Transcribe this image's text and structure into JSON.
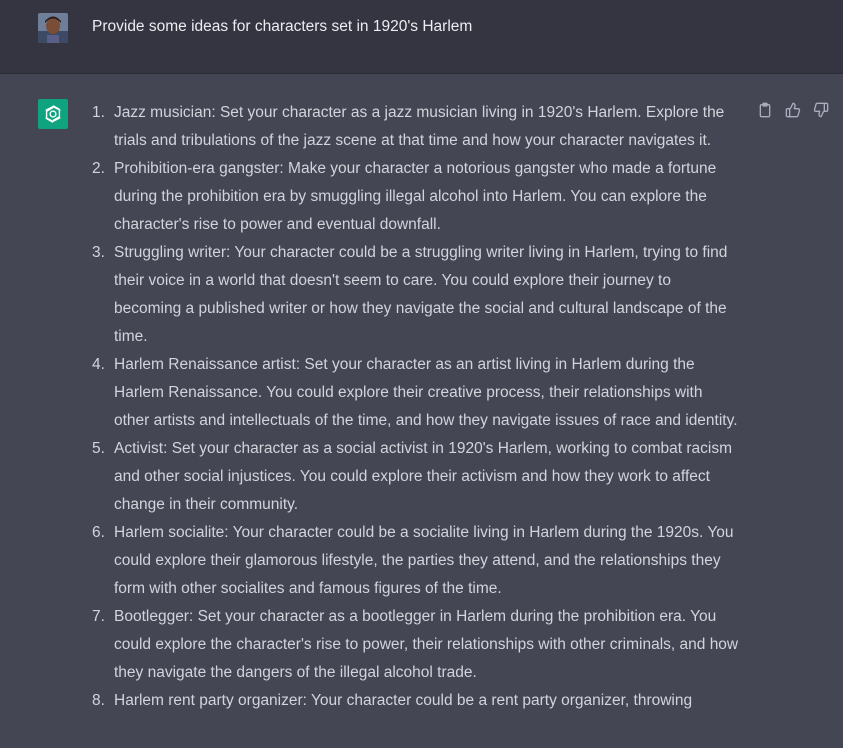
{
  "user_message": {
    "text": "Provide some ideas for characters set in 1920's Harlem"
  },
  "assistant_message": {
    "items": [
      {
        "num": "1.",
        "text": "Jazz musician: Set your character as a jazz musician living in 1920's Harlem. Explore the trials and tribulations of the jazz scene at that time and how your character navigates it."
      },
      {
        "num": "2.",
        "text": "Prohibition-era gangster: Make your character a notorious gangster who made a fortune during the prohibition era by smuggling illegal alcohol into Harlem. You can explore the character's rise to power and eventual downfall."
      },
      {
        "num": "3.",
        "text": "Struggling writer: Your character could be a struggling writer living in Harlem, trying to find their voice in a world that doesn't seem to care. You could explore their journey to becoming a published writer or how they navigate the social and cultural landscape of the time."
      },
      {
        "num": "4.",
        "text": "Harlem Renaissance artist: Set your character as an artist living in Harlem during the Harlem Renaissance. You could explore their creative process, their relationships with other artists and intellectuals of the time, and how they navigate issues of race and identity."
      },
      {
        "num": "5.",
        "text": "Activist: Set your character as a social activist in 1920's Harlem, working to combat racism and other social injustices. You could explore their activism and how they work to affect change in their community."
      },
      {
        "num": "6.",
        "text": "Harlem socialite: Your character could be a socialite living in Harlem during the 1920s. You could explore their glamorous lifestyle, the parties they attend, and the relationships they form with other socialites and famous figures of the time."
      },
      {
        "num": "7.",
        "text": "Bootlegger: Set your character as a bootlegger in Harlem during the prohibition era. You could explore the character's rise to power, their relationships with other criminals, and how they navigate the dangers of the illegal alcohol trade."
      },
      {
        "num": "8.",
        "text": "Harlem rent party organizer: Your character could be a rent party organizer, throwing"
      }
    ]
  },
  "icons": {
    "copy": "clipboard-icon",
    "like": "thumbs-up-icon",
    "dislike": "thumbs-down-icon",
    "logo": "openai-logo-icon"
  },
  "colors": {
    "user_bg": "#343541",
    "assistant_bg": "#444654",
    "logo_bg": "#10a37f",
    "text": "#d1d5db"
  }
}
